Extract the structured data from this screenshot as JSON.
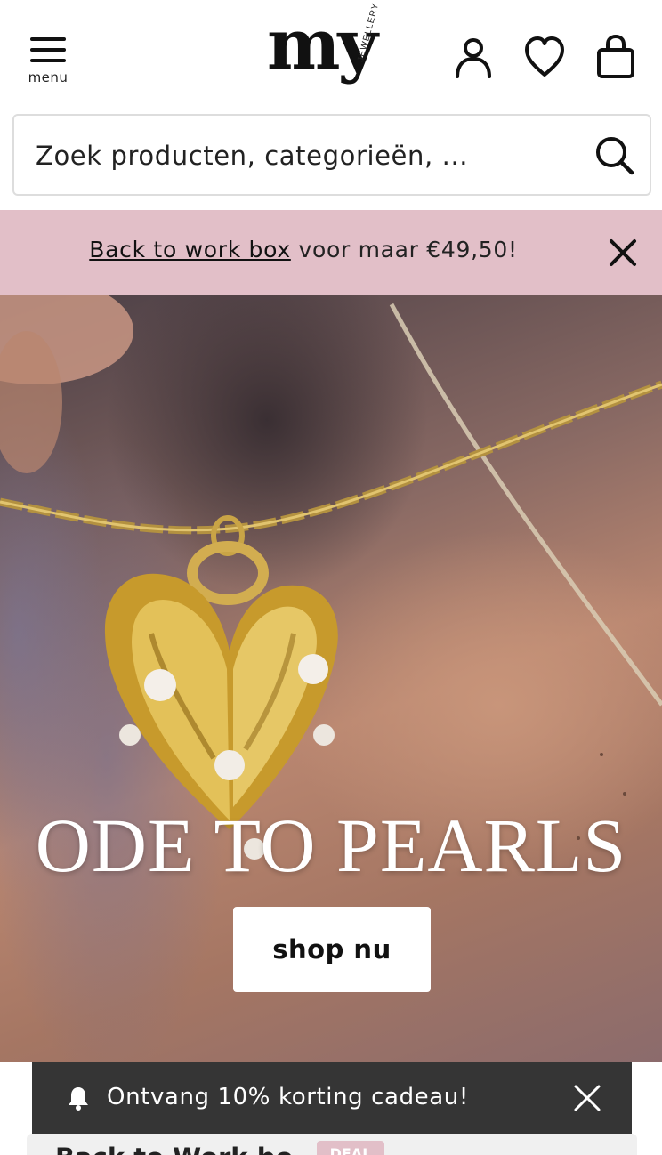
{
  "header": {
    "menu_label": "menu",
    "logo_main": "my",
    "logo_sub": "JEWELLERY",
    "icons": [
      "menu-icon",
      "account-icon",
      "heart-icon",
      "shopping-bag-icon"
    ]
  },
  "search": {
    "placeholder": "Zoek producten, categorieën, ...",
    "icon": "search-icon"
  },
  "promo_bar": {
    "link_text": "Back to work box",
    "text": " voor maar €49,50!",
    "background": "#e2bfc8",
    "close_icon": "close-icon"
  },
  "hero": {
    "title": "ODE TO PEARLS",
    "button_label": "shop nu"
  },
  "toast": {
    "icon": "bell-icon",
    "text": "Ontvang 10% korting cadeau!",
    "close_icon": "close-icon",
    "background": "#353535"
  },
  "below_card": {
    "title": "Back to Work bo",
    "badge": "DEAL"
  }
}
